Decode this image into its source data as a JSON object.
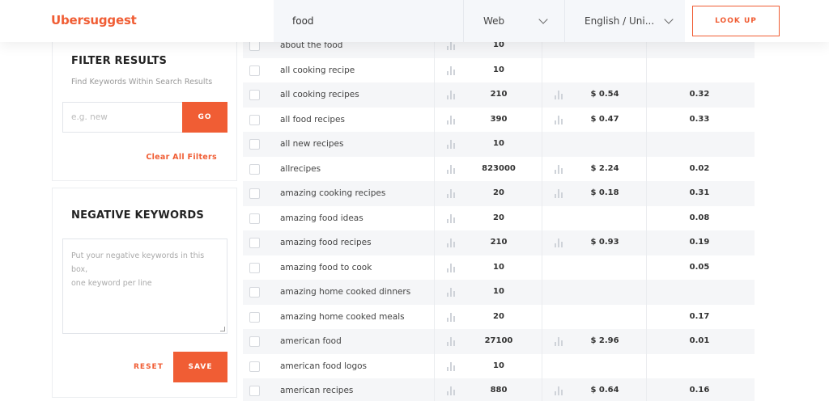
{
  "header": {
    "logo": "Ubersuggest",
    "search_value": "food",
    "source_select": "Web",
    "language_select": "English / Uni...",
    "lookup_label": "LOOK UP"
  },
  "filter": {
    "title": "FILTER RESULTS",
    "subtitle": "Find Keywords Within Search Results",
    "input_placeholder": "e.g. new",
    "go_label": "GO",
    "clear_label": "Clear All Filters"
  },
  "negative": {
    "title": "NEGATIVE KEYWORDS",
    "placeholder_line1": "Put your negative keywords in this box,",
    "placeholder_line2": "one keyword per line",
    "reset_label": "RESET",
    "save_label": "SAVE"
  },
  "rows": [
    {
      "keyword": "about the food",
      "volume": "10",
      "cpc": "",
      "competition": ""
    },
    {
      "keyword": "all cooking recipe",
      "volume": "10",
      "cpc": "",
      "competition": ""
    },
    {
      "keyword": "all cooking recipes",
      "volume": "210",
      "cpc": "$ 0.54",
      "competition": "0.32"
    },
    {
      "keyword": "all food recipes",
      "volume": "390",
      "cpc": "$ 0.47",
      "competition": "0.33"
    },
    {
      "keyword": "all new recipes",
      "volume": "10",
      "cpc": "",
      "competition": ""
    },
    {
      "keyword": "allrecipes",
      "volume": "823000",
      "cpc": "$ 2.24",
      "competition": "0.02"
    },
    {
      "keyword": "amazing cooking recipes",
      "volume": "20",
      "cpc": "$ 0.18",
      "competition": "0.31"
    },
    {
      "keyword": "amazing food ideas",
      "volume": "20",
      "cpc": "",
      "competition": "0.08"
    },
    {
      "keyword": "amazing food recipes",
      "volume": "210",
      "cpc": "$ 0.93",
      "competition": "0.19"
    },
    {
      "keyword": "amazing food to cook",
      "volume": "10",
      "cpc": "",
      "competition": "0.05"
    },
    {
      "keyword": "amazing home cooked dinners",
      "volume": "10",
      "cpc": "",
      "competition": ""
    },
    {
      "keyword": "amazing home cooked meals",
      "volume": "20",
      "cpc": "",
      "competition": "0.17"
    },
    {
      "keyword": "american food",
      "volume": "27100",
      "cpc": "$ 2.96",
      "competition": "0.01"
    },
    {
      "keyword": "american food logos",
      "volume": "10",
      "cpc": "",
      "competition": ""
    },
    {
      "keyword": "american recipes",
      "volume": "880",
      "cpc": "$ 0.64",
      "competition": "0.16"
    }
  ],
  "colors": {
    "accent": "#f05d34",
    "row_alt": "#f5f6f8"
  }
}
